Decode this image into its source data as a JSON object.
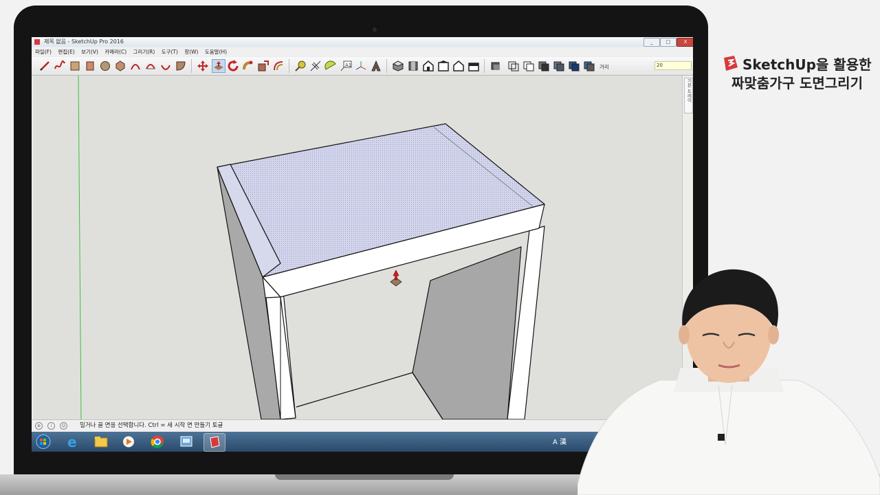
{
  "window": {
    "title": "제목 없음 - SketchUp Pro 2016",
    "minimize": "_",
    "maximize": "□",
    "close": "X"
  },
  "menu": [
    "파일(F)",
    "편집(E)",
    "보기(V)",
    "카메라(C)",
    "그리기(R)",
    "도구(T)",
    "창(W)",
    "도움말(H)"
  ],
  "toolbar": {
    "tools": [
      "pencil-icon",
      "freehand-icon",
      "rectangle-icon",
      "rotated-rectangle-icon",
      "circle-icon",
      "polygon-icon",
      "arc-icon",
      "two-point-arc-icon",
      "three-point-arc-icon",
      "pie-icon",
      "move-icon",
      "push-pull-icon",
      "rotate-icon",
      "follow-me-icon",
      "scale-icon",
      "offset-icon",
      "tape-measure-icon",
      "dimension-icon",
      "protractor-icon",
      "text-icon",
      "axes-icon",
      "3d-text-icon",
      "iso-view-icon",
      "top-view-icon",
      "front-view-icon",
      "right-view-icon",
      "back-view-icon",
      "left-view-icon",
      "xray-style-icon",
      "wireframe-style-icon",
      "hidden-line-style-icon",
      "shaded-style-icon",
      "textured-style-icon",
      "monochrome-style-icon"
    ],
    "active_tool": "push-pull-icon",
    "measurement_label": "거리",
    "measurement_value": "20"
  },
  "tray_tab": "기본 트레이",
  "status": {
    "text": "밀거나 끌 면을 선택합니다. Ctrl = 새 시작 면 만들기 토글"
  },
  "taskbar": {
    "tray_text": "A 漢"
  },
  "brand": {
    "line1": "SketchUp을 활용한",
    "line2": "짜맞춤가구 도면그리기",
    "color": "#d63a3a"
  }
}
